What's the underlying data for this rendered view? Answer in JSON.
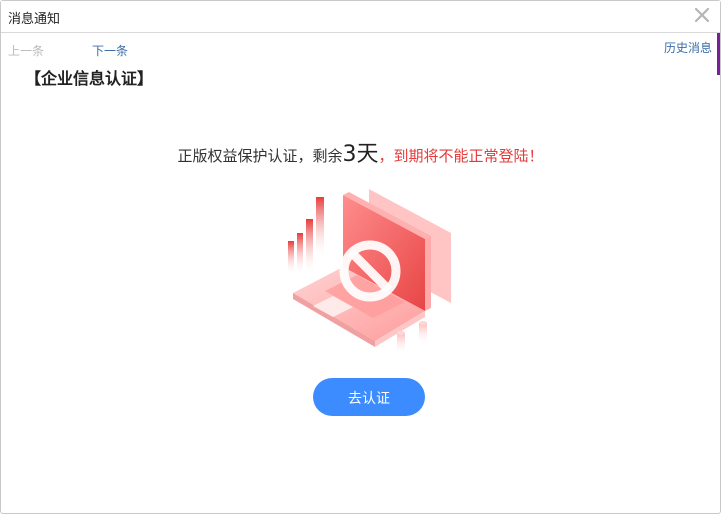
{
  "window": {
    "title": "消息通知",
    "close_icon": "close-icon"
  },
  "nav": {
    "prev_label": "上一条",
    "next_label": "下一条",
    "history_label": "历史消息"
  },
  "notice": {
    "heading": "【企业信息认证】",
    "message_prefix": "正版权益保护认证，剩余",
    "days_value": "3天",
    "message_suffix": "，到期将不能正常登陆！",
    "illustration_icon": "laptop-blocked-illustration"
  },
  "actions": {
    "verify_label": "去认证"
  },
  "colors": {
    "accent": "#3d8cff",
    "warning": "#e53b3b",
    "link": "#3b6ea8"
  }
}
